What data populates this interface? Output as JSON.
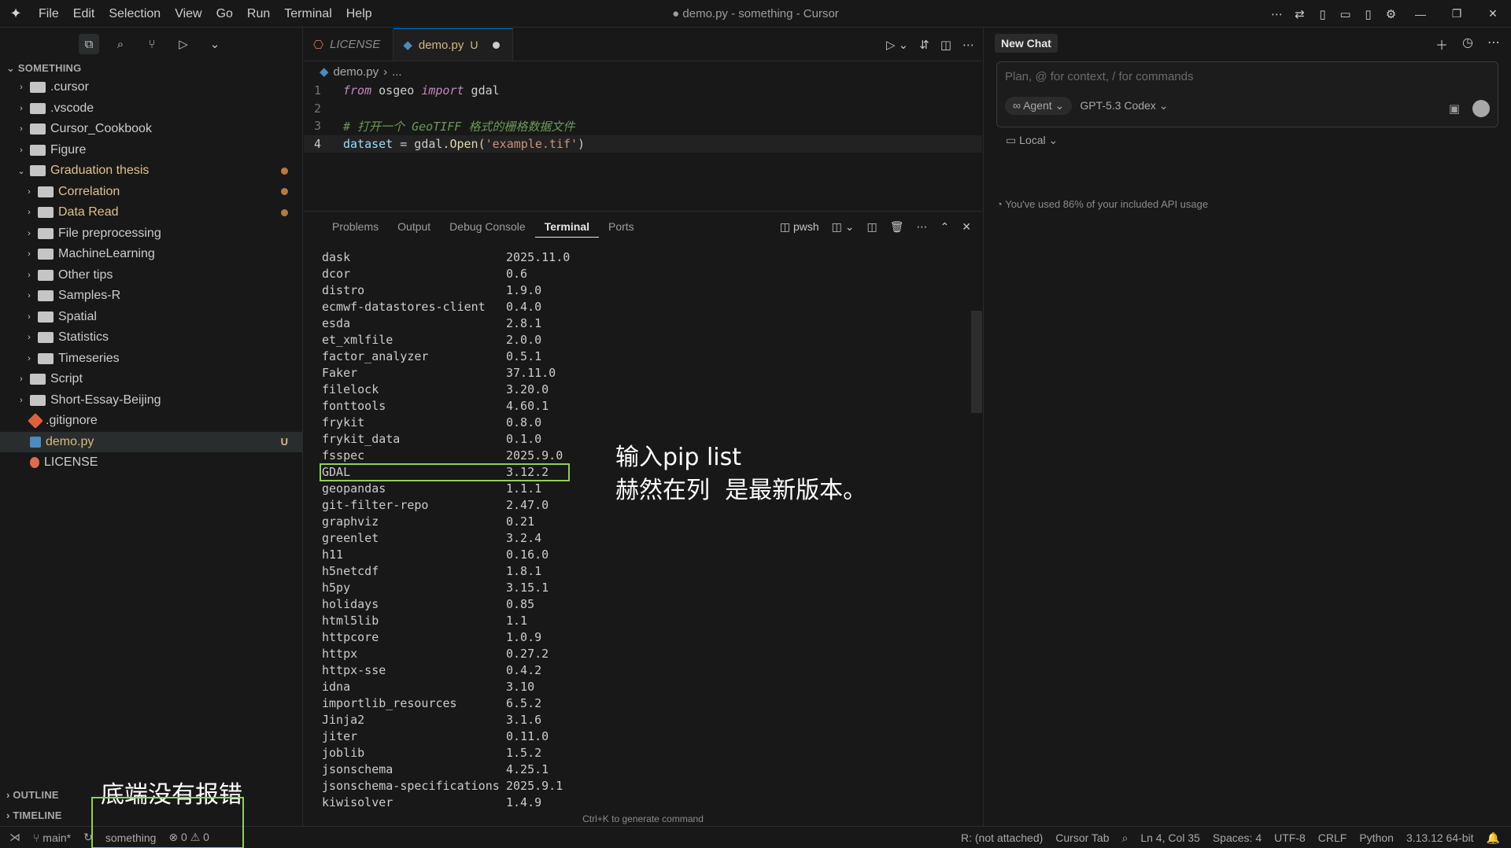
{
  "menu": [
    "File",
    "Edit",
    "Selection",
    "View",
    "Go",
    "Run",
    "Terminal",
    "Help"
  ],
  "window_title": "● demo.py - something - Cursor",
  "explorer": {
    "root": "SOMETHING",
    "items": [
      {
        "label": ".cursor",
        "depth": 0,
        "chevron": "›"
      },
      {
        "label": ".vscode",
        "depth": 0,
        "chevron": "›"
      },
      {
        "label": "Cursor_Cookbook",
        "depth": 0,
        "chevron": "›"
      },
      {
        "label": "Figure",
        "depth": 0,
        "chevron": "›"
      },
      {
        "label": "Graduation thesis",
        "depth": 0,
        "chevron": "⌄"
      },
      {
        "label": "Correlation",
        "depth": 1,
        "chevron": "›"
      },
      {
        "label": "Data Read",
        "depth": 1,
        "chevron": "›"
      },
      {
        "label": "File preprocessing",
        "depth": 1,
        "chevron": "›"
      },
      {
        "label": "MachineLearning",
        "depth": 1,
        "chevron": "›"
      },
      {
        "label": "Other tips",
        "depth": 1,
        "chevron": "›"
      },
      {
        "label": "Samples-R",
        "depth": 1,
        "chevron": "›"
      },
      {
        "label": "Spatial",
        "depth": 1,
        "chevron": "›"
      },
      {
        "label": "Statistics",
        "depth": 1,
        "chevron": "›"
      },
      {
        "label": "Timeseries",
        "depth": 1,
        "chevron": "›"
      },
      {
        "label": "Script",
        "depth": 0,
        "chevron": "›"
      },
      {
        "label": "Short-Essay-Beijing",
        "depth": 0,
        "chevron": "›"
      },
      {
        "label": ".gitignore",
        "depth": 0,
        "chevron": ""
      },
      {
        "label": "demo.py",
        "depth": 0,
        "chevron": "",
        "badge": "U"
      },
      {
        "label": "LICENSE",
        "depth": 0,
        "chevron": ""
      }
    ],
    "outline": "OUTLINE",
    "timeline": "TIMELINE"
  },
  "tabs": {
    "license": "LICENSE",
    "demo": "demo.py",
    "demo_badge": "U"
  },
  "breadcrumb": {
    "file": "demo.py",
    "rest": "..."
  },
  "code": {
    "l1_kw1": "from",
    "l1_mod": " osgeo ",
    "l1_kw2": "import",
    "l1_name": " gdal",
    "l3": "# 打开一个 GeoTIFF 格式的栅格数据文件",
    "l4_var": "dataset",
    "l4_eq": " = gdal.",
    "l4_fn": "Open",
    "l4_p1": "(",
    "l4_str": "'example.tif'",
    "l4_p2": ")",
    "numbers": [
      "1",
      "2",
      "3",
      "4"
    ]
  },
  "panel": {
    "tabs": [
      "Problems",
      "Output",
      "Debug Console",
      "Terminal",
      "Ports"
    ],
    "shell": "pwsh",
    "hint": "Ctrl+K to generate command"
  },
  "packages": [
    [
      "dask",
      "2025.11.0"
    ],
    [
      "dcor",
      "0.6"
    ],
    [
      "distro",
      "1.9.0"
    ],
    [
      "ecmwf-datastores-client",
      "0.4.0"
    ],
    [
      "esda",
      "2.8.1"
    ],
    [
      "et_xmlfile",
      "2.0.0"
    ],
    [
      "factor_analyzer",
      "0.5.1"
    ],
    [
      "Faker",
      "37.11.0"
    ],
    [
      "filelock",
      "3.20.0"
    ],
    [
      "fonttools",
      "4.60.1"
    ],
    [
      "frykit",
      "0.8.0"
    ],
    [
      "frykit_data",
      "0.1.0"
    ],
    [
      "fsspec",
      "2025.9.0"
    ],
    [
      "GDAL",
      "3.12.2"
    ],
    [
      "geopandas",
      "1.1.1"
    ],
    [
      "git-filter-repo",
      "2.47.0"
    ],
    [
      "graphviz",
      "0.21"
    ],
    [
      "greenlet",
      "3.2.4"
    ],
    [
      "h11",
      "0.16.0"
    ],
    [
      "h5netcdf",
      "1.8.1"
    ],
    [
      "h5py",
      "3.15.1"
    ],
    [
      "holidays",
      "0.85"
    ],
    [
      "html5lib",
      "1.1"
    ],
    [
      "httpcore",
      "1.0.9"
    ],
    [
      "httpx",
      "0.27.2"
    ],
    [
      "httpx-sse",
      "0.4.2"
    ],
    [
      "idna",
      "3.10"
    ],
    [
      "importlib_resources",
      "6.5.2"
    ],
    [
      "Jinja2",
      "3.1.6"
    ],
    [
      "jiter",
      "0.11.0"
    ],
    [
      "joblib",
      "1.5.2"
    ],
    [
      "jsonschema",
      "4.25.1"
    ],
    [
      "jsonschema-specifications",
      "2025.9.1"
    ],
    [
      "kiwisolver",
      "1.4.9"
    ]
  ],
  "annotations": {
    "line1": "输入pip list",
    "line2": "赫然在列  是最新版本。",
    "bottom": "底端没有报错"
  },
  "chat": {
    "tab": "New Chat",
    "placeholder": "Plan, @ for context, / for commands",
    "agent": "∞ Agent ⌄",
    "model": "GPT-5.3 Codex ⌄",
    "local": "Local ⌄",
    "usage": "You've used 86% of your included API usage"
  },
  "status": {
    "branch": "main*",
    "workspace": "something",
    "problems": "⊗ 0 ⚠ 0",
    "r": "R: (not attached)",
    "cursor_tab": "Cursor Tab",
    "position": "Ln 4, Col 35",
    "spaces": "Spaces: 4",
    "encoding": "UTF-8",
    "eol": "CRLF",
    "language": "Python",
    "interpreter": "3.13.12 64-bit"
  },
  "colors": {
    "accent": "#0078d4",
    "highlight": "#8fd14f",
    "modified": "#e2c08d"
  }
}
